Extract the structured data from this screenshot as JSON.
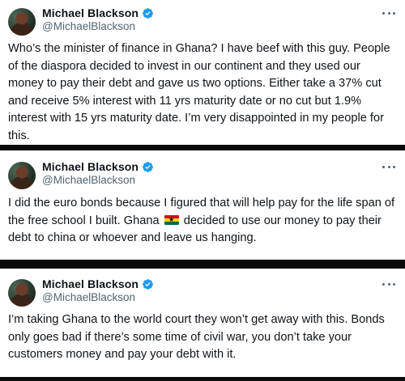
{
  "tweets": [
    {
      "author": "Michael Blackson",
      "handle": "@MichaelBlackson",
      "text": "Who’s the minister of finance in Ghana? I have beef with this guy. People of the diaspora decided to invest in our continent and they used our money to pay their debt and gave us two options. Either take a 37% cut and receive 5% interest with 11 yrs maturity date or no cut but 1.9% interest with 15 yrs maturity date. I’m very disappointed in my people for this."
    },
    {
      "author": "Michael Blackson",
      "handle": "@MichaelBlackson",
      "text_before_flag": "I did the euro bonds because I figured that will help pay for the life span of the free school I built. Ghana",
      "text_after_flag": "decided to use our money to pay their debt to china or whoever and leave us hanging."
    },
    {
      "author": "Michael Blackson",
      "handle": "@MichaelBlackson",
      "text": "I’m taking Ghana to the world court they won’t get away with this. Bonds only goes bad if there’s some time of civil war, you don’t take your customers money and pay your debt with it."
    }
  ],
  "icons": {
    "verified": "verified-badge-icon",
    "more": "more-options-icon",
    "flag": "ghana-flag-emoji"
  },
  "colors": {
    "verified_blue": "#1d9bf0",
    "text": "#0f1419",
    "secondary": "#536471",
    "separator": "#0b0b0b"
  }
}
